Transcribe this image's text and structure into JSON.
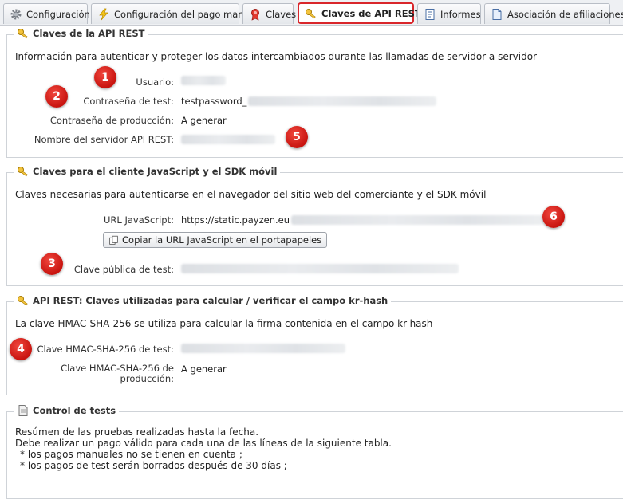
{
  "tabs": [
    {
      "label": "Configuración",
      "icon": "gear-icon"
    },
    {
      "label": "Configuración del pago manual",
      "icon": "lightning-icon"
    },
    {
      "label": "Claves",
      "icon": "certificate-icon"
    },
    {
      "label": "Claves de API REST",
      "icon": "key-icon",
      "active": true
    },
    {
      "label": "Informes",
      "icon": "report-icon"
    },
    {
      "label": "Asociación de afiliaciones",
      "icon": "document-icon"
    }
  ],
  "colors": {
    "highlight": "#d9262b",
    "badge": "#d42018",
    "border": "#cfd3d8"
  },
  "rest_keys": {
    "legend": "Claves de la API REST",
    "intro": "Información para autenticar y proteger los datos intercambiados durante las llamadas de servidor a servidor",
    "user_label": "Usuario:",
    "test_password_label": "Contraseña de test:",
    "test_password_value": "testpassword_",
    "prod_password_label": "Contraseña de producción:",
    "prod_password_value": "A generar",
    "server_label": "Nombre del servidor API REST:"
  },
  "js_keys": {
    "legend": "Claves para el cliente JavaScript y el SDK móvil",
    "intro": "Claves necesarias para autenticarse en el navegador del sitio web del comerciante y el SDK móvil",
    "url_label": "URL JavaScript:",
    "url_value": "https://static.payzen.eu",
    "copy_button": "Copiar la URL JavaScript en el portapapeles",
    "public_key_label": "Clave pública de test:"
  },
  "hmac": {
    "legend": "API REST: Claves utilizadas para calcular / verificar el campo kr-hash",
    "intro": "La clave HMAC-SHA-256 se utiliza para calcular la firma contenida en el campo kr-hash",
    "test_label": "Clave HMAC-SHA-256 de test:",
    "prod_label_1": "Clave HMAC-SHA-256 de",
    "prod_label_2": "producción:",
    "prod_value": "A generar"
  },
  "tests": {
    "legend": "Control de tests",
    "line1": "Resúmen de las pruebas realizadas hasta la fecha.",
    "line2": "Debe realizar un pago válido para cada una de las líneas de la siguiente tabla.",
    "line3": "* los pagos manuales no se tienen en cuenta ;",
    "line4": "* los pagos de test serán borrados después de 30 días ;"
  },
  "badges": [
    "1",
    "2",
    "3",
    "4",
    "5",
    "6"
  ]
}
